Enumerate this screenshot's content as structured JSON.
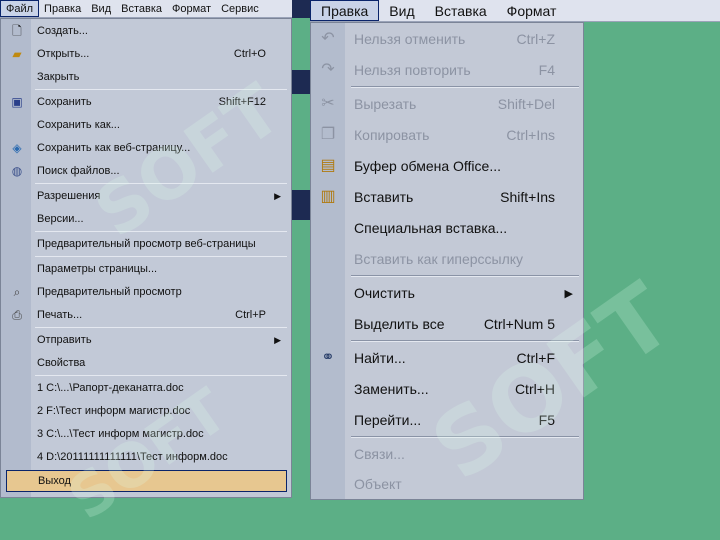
{
  "left_menubar": {
    "items": [
      "Файл",
      "Правка",
      "Вид",
      "Вставка",
      "Формат",
      "Сервис"
    ],
    "active_index": 0
  },
  "file_menu": {
    "items": [
      {
        "label": "Создать...",
        "shortcut": "",
        "icon": "new-document-icon",
        "submenu": false,
        "selected": false
      },
      {
        "label": "Открыть...",
        "shortcut": "Ctrl+O",
        "icon": "open-folder-icon",
        "submenu": false,
        "selected": false
      },
      {
        "label": "Закрыть",
        "shortcut": "",
        "icon": "",
        "submenu": false,
        "selected": false
      },
      {
        "label": "Сохранить",
        "shortcut": "Shift+F12",
        "icon": "save-disk-icon",
        "submenu": false,
        "selected": false
      },
      {
        "label": "Сохранить как...",
        "shortcut": "",
        "icon": "",
        "submenu": false,
        "selected": false
      },
      {
        "label": "Сохранить как веб-страницу...",
        "shortcut": "",
        "icon": "save-web-icon",
        "submenu": false,
        "selected": false
      },
      {
        "label": "Поиск файлов...",
        "shortcut": "",
        "icon": "file-search-icon",
        "submenu": false,
        "selected": false
      },
      {
        "label": "Разрешения",
        "shortcut": "",
        "icon": "",
        "submenu": true,
        "selected": false
      },
      {
        "label": "Версии...",
        "shortcut": "",
        "icon": "",
        "submenu": false,
        "selected": false
      },
      {
        "label": "Предварительный просмотр веб-страницы",
        "shortcut": "",
        "icon": "",
        "submenu": false,
        "selected": false
      },
      {
        "label": "Параметры страницы...",
        "shortcut": "",
        "icon": "",
        "submenu": false,
        "selected": false
      },
      {
        "label": "Предварительный просмотр",
        "shortcut": "",
        "icon": "print-preview-icon",
        "submenu": false,
        "selected": false
      },
      {
        "label": "Печать...",
        "shortcut": "Ctrl+P",
        "icon": "printer-icon",
        "submenu": false,
        "selected": false
      },
      {
        "label": "Отправить",
        "shortcut": "",
        "icon": "",
        "submenu": true,
        "selected": false
      },
      {
        "label": "Свойства",
        "shortcut": "",
        "icon": "",
        "submenu": false,
        "selected": false
      },
      {
        "label": "1 C:\\...\\Рапорт-деканатга.doc",
        "shortcut": "",
        "icon": "",
        "submenu": false,
        "selected": false
      },
      {
        "label": "2 F:\\Тест информ магистр.doc",
        "shortcut": "",
        "icon": "",
        "submenu": false,
        "selected": false
      },
      {
        "label": "3 C:\\...\\Тест информ магистр.doc",
        "shortcut": "",
        "icon": "",
        "submenu": false,
        "selected": false
      },
      {
        "label": "4 D:\\20111111111111\\Тест информ.doc",
        "shortcut": "",
        "icon": "",
        "submenu": false,
        "selected": false
      },
      {
        "label": "Выход",
        "shortcut": "",
        "icon": "",
        "submenu": false,
        "selected": true
      }
    ]
  },
  "right_menubar": {
    "items": [
      "Правка",
      "Вид",
      "Вставка",
      "Формат"
    ],
    "active_index": 0
  },
  "edit_menu": {
    "items": [
      {
        "label": "Нельзя отменить",
        "shortcut": "Ctrl+Z",
        "icon": "undo-icon",
        "disabled": true,
        "submenu": false
      },
      {
        "label": "Нельзя повторить",
        "shortcut": "F4",
        "icon": "redo-icon",
        "disabled": true,
        "submenu": false
      },
      {
        "label": "Вырезать",
        "shortcut": "Shift+Del",
        "icon": "scissors-icon",
        "disabled": true,
        "submenu": false
      },
      {
        "label": "Копировать",
        "shortcut": "Ctrl+Ins",
        "icon": "copy-icon",
        "disabled": true,
        "submenu": false
      },
      {
        "label": "Буфер обмена Office...",
        "shortcut": "",
        "icon": "office-clipboard-icon",
        "disabled": false,
        "submenu": false
      },
      {
        "label": "Вставить",
        "shortcut": "Shift+Ins",
        "icon": "paste-icon",
        "disabled": false,
        "submenu": false
      },
      {
        "label": "Специальная вставка...",
        "shortcut": "",
        "icon": "",
        "disabled": false,
        "submenu": false
      },
      {
        "label": "Вставить как гиперссылку",
        "shortcut": "",
        "icon": "",
        "disabled": true,
        "submenu": false
      },
      {
        "label": "Очистить",
        "shortcut": "",
        "icon": "",
        "disabled": false,
        "submenu": true
      },
      {
        "label": "Выделить все",
        "shortcut": "Ctrl+Num 5",
        "icon": "",
        "disabled": false,
        "submenu": false
      },
      {
        "label": "Найти...",
        "shortcut": "Ctrl+F",
        "icon": "binoculars-icon",
        "disabled": false,
        "submenu": false
      },
      {
        "label": "Заменить...",
        "shortcut": "Ctrl+H",
        "icon": "",
        "disabled": false,
        "submenu": false
      },
      {
        "label": "Перейти...",
        "shortcut": "F5",
        "icon": "",
        "disabled": false,
        "submenu": false
      },
      {
        "label": "Связи...",
        "shortcut": "",
        "icon": "",
        "disabled": true,
        "submenu": false
      },
      {
        "label": "Объект",
        "shortcut": "",
        "icon": "",
        "disabled": true,
        "submenu": false
      }
    ]
  },
  "watermark": {
    "text": "SOFT"
  },
  "colors": {
    "background": "#5caf86",
    "menu": "#c3c9d6",
    "icon_column": "#b3bccd",
    "selected_item": "#e7c790",
    "disabled_text": "#8c93a3"
  }
}
